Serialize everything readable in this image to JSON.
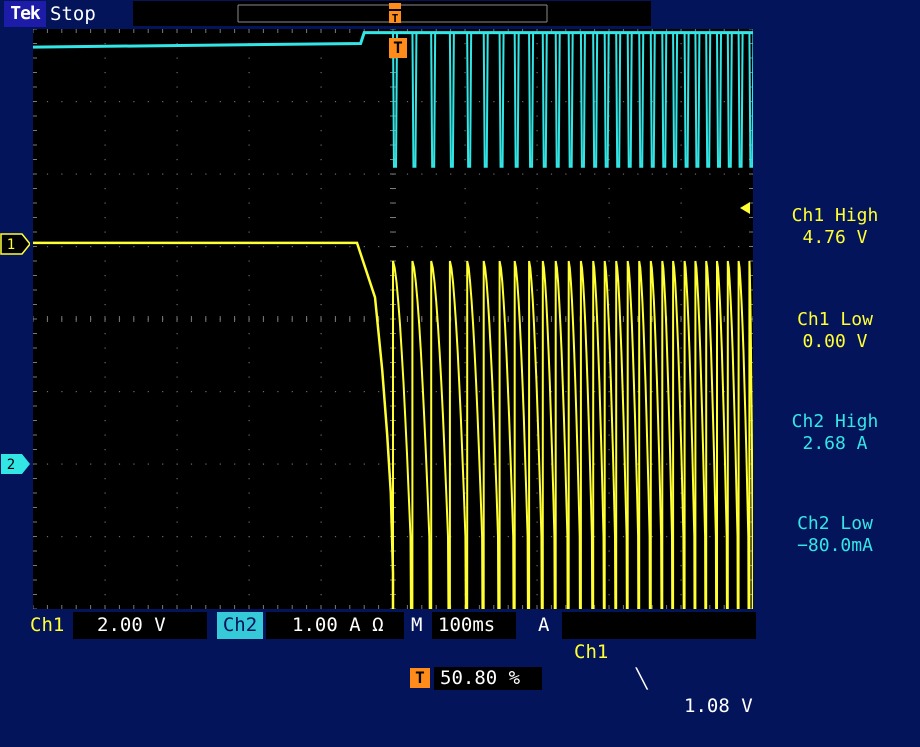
{
  "topbar": {
    "logo": "Tek",
    "status": "Stop"
  },
  "trigger_marker": "T",
  "channel_markers": {
    "ch1": "1",
    "ch2": "2"
  },
  "measurements": [
    {
      "label": "Ch1 High",
      "value": "4.76 V",
      "channel": "ch1"
    },
    {
      "label": "Ch1 Low",
      "value": "0.00 V",
      "channel": "ch1"
    },
    {
      "label": "Ch2 High",
      "value": "2.68 A",
      "channel": "ch2"
    },
    {
      "label": "Ch2 Low",
      "value": "−80.0mA",
      "channel": "ch2"
    }
  ],
  "bottom": {
    "ch1_label": "Ch1",
    "ch1_scale": "2.00 V",
    "ch2_label": "Ch2",
    "ch2_scale": "1.00 A Ω",
    "time_label": "M",
    "time_scale": "100ms",
    "trigger_label": "A",
    "trigger_source": "Ch1",
    "trigger_slope": "╲",
    "trigger_level": "1.08 V",
    "trigger_position": "50.80 %"
  },
  "colors": {
    "ch1": "#ffff33",
    "ch2": "#33e6e6",
    "background": "#04145a",
    "trigger": "#ff8c1a"
  },
  "chart_data": {
    "type": "line",
    "title": "",
    "xlabel": "",
    "ylabel": "",
    "grid": true,
    "divisions": {
      "x": 10,
      "y": 8
    },
    "trigger_time_div": 5.2,
    "series": [
      {
        "name": "Ch1",
        "x_div": [
          0,
          4.5,
          4.75,
          4.85,
          4.92,
          4.97,
          5.0,
          5.0
        ],
        "y_div": [
          5.05,
          5.05,
          4.3,
          3.3,
          2.4,
          1.6,
          0.5,
          0.0
        ],
        "pulses": {
          "start_div": 5.0,
          "end_div": 10.0,
          "rise_times_div": [
            5.0,
            5.27,
            5.53,
            5.79,
            6.03,
            6.26,
            6.48,
            6.69,
            6.89,
            7.08,
            7.26,
            7.44,
            7.61,
            7.78,
            7.94,
            8.1,
            8.26,
            8.42,
            8.58,
            8.74,
            8.89,
            9.05,
            9.2,
            9.35,
            9.5,
            9.65,
            9.8,
            9.95
          ],
          "high_div": 4.8,
          "low_div": 0.0
        }
      },
      {
        "name": "Ch2",
        "x_div": [
          0,
          4.55,
          4.6,
          10.0
        ],
        "y_div": [
          7.75,
          7.8,
          7.95,
          7.95
        ],
        "pulses": {
          "start_div": 5.0,
          "end_div": 10.0,
          "drop_times_div": [
            5.0,
            5.27,
            5.53,
            5.79,
            6.03,
            6.26,
            6.48,
            6.69,
            6.89,
            7.08,
            7.26,
            7.44,
            7.61,
            7.78,
            7.94,
            8.1,
            8.26,
            8.42,
            8.58,
            8.74,
            8.89,
            9.05,
            9.2,
            9.35,
            9.5,
            9.65,
            9.8,
            9.95
          ],
          "low_div": 6.1,
          "high_div": 7.95
        }
      }
    ]
  }
}
